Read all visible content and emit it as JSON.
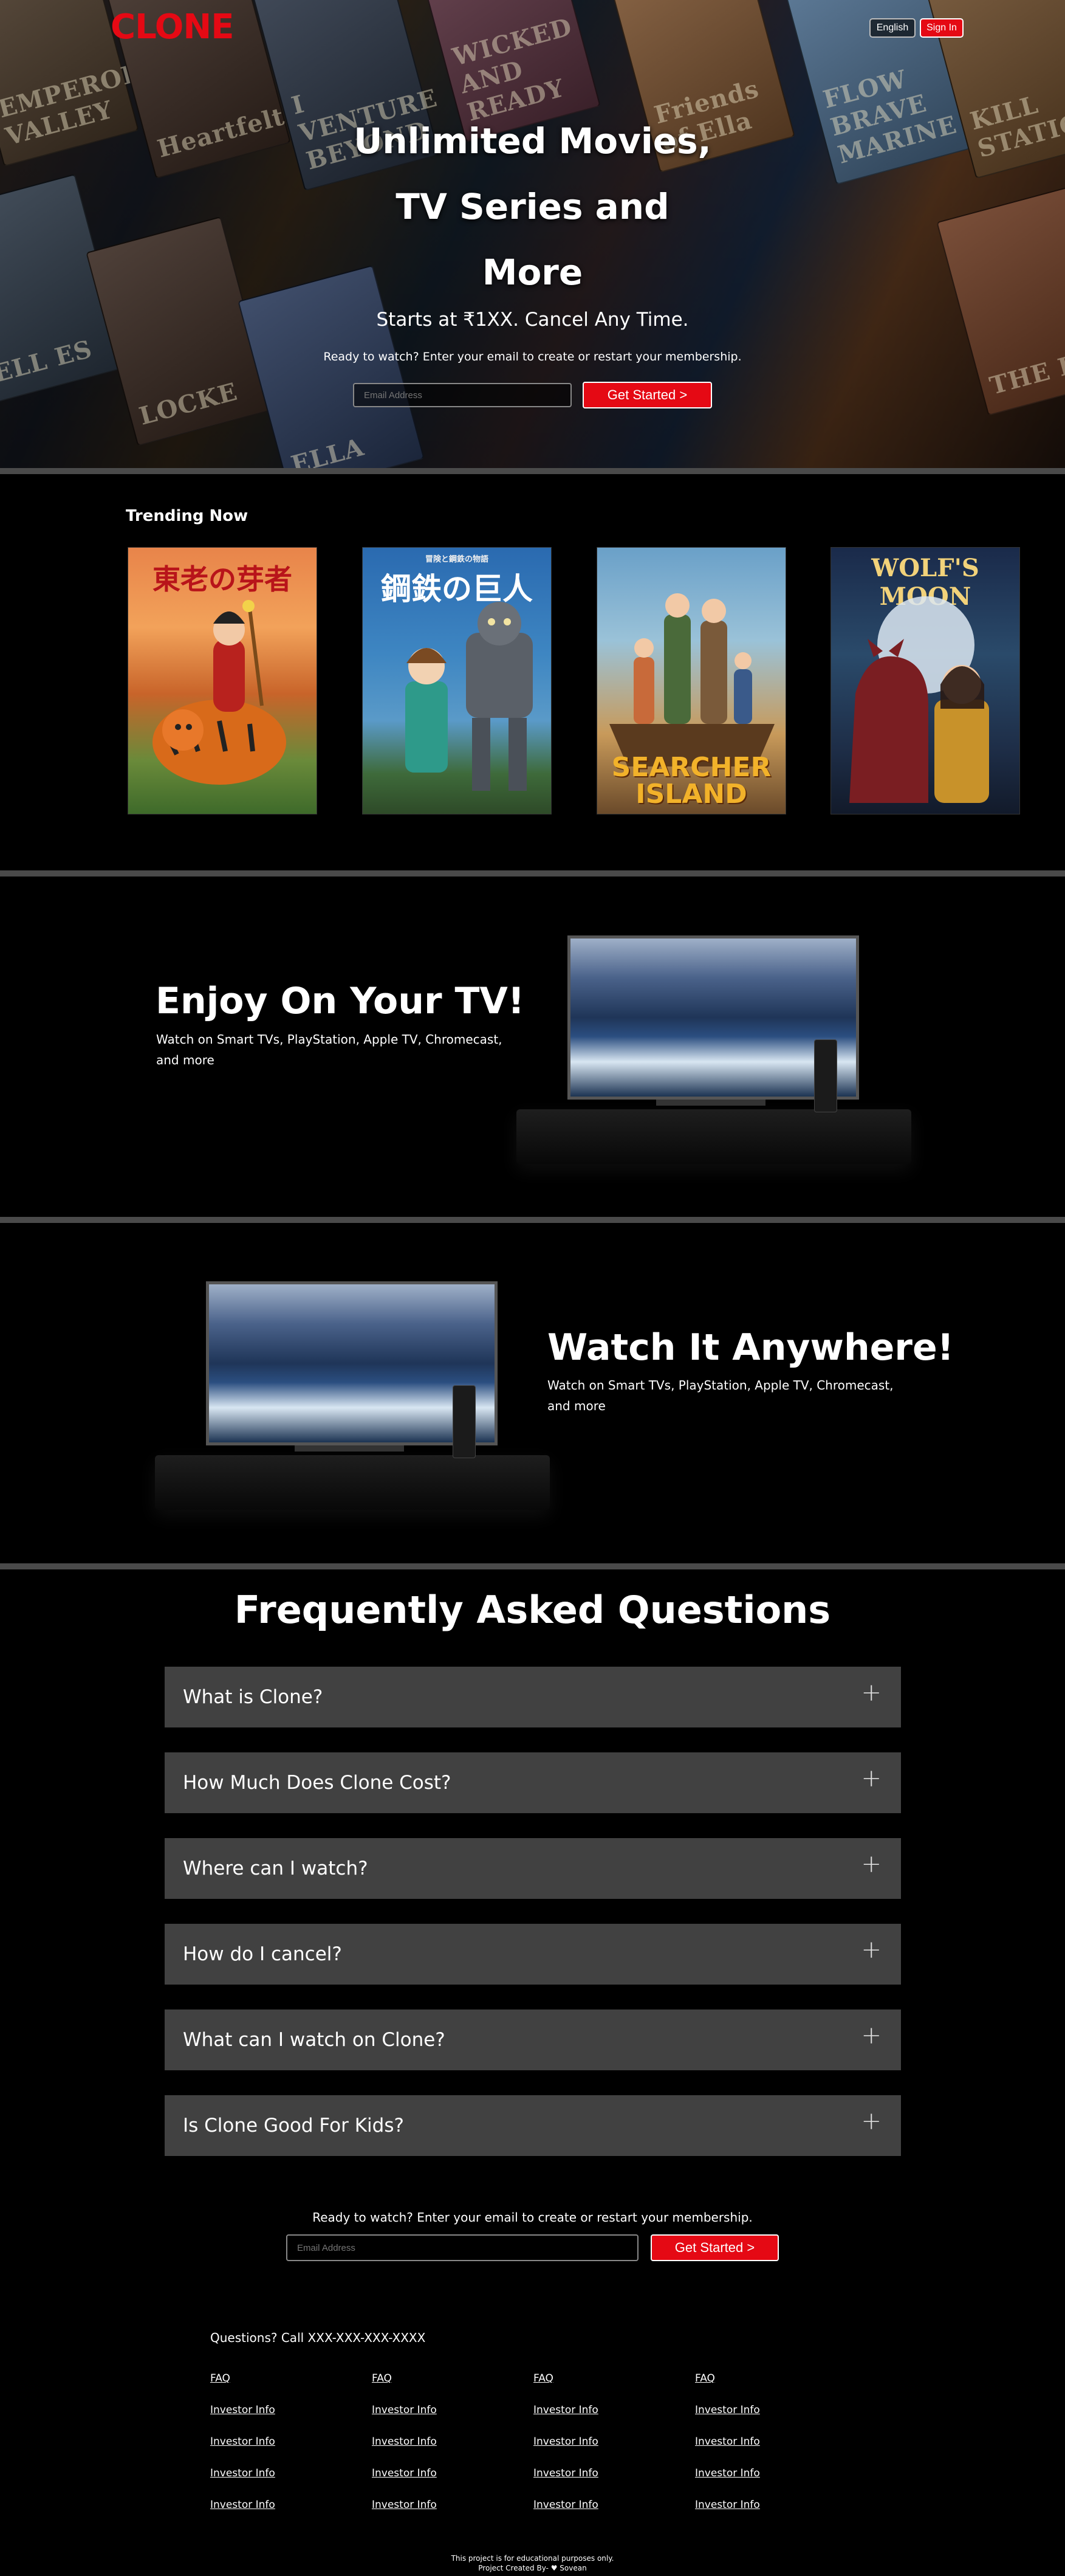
{
  "brand": {
    "logo": "CLONE",
    "accent": "#e50914"
  },
  "header": {
    "language_label": "English",
    "signin_label": "Sign In"
  },
  "hero": {
    "title_lines": [
      "Unlimited Movies,",
      "TV Series and",
      "More"
    ],
    "subtitle": "Starts at ₹1XX. Cancel Any Time.",
    "prompt": "Ready to watch? Enter your email to create or restart your membership.",
    "email_placeholder": "Email Address",
    "cta_label": "Get Started >",
    "background_posters": [
      "EMPEROR VALLEY",
      "Heartfelt",
      "I VENTURE BEYOND",
      "WICKED AND READY",
      "Friends of Ella",
      "FLOW BRAVE MARINE",
      "KILL STATION",
      "ELL ES",
      "LOCKE",
      "ELLA",
      "THE PI"
    ]
  },
  "trending": {
    "title": "Trending Now",
    "items": [
      {
        "title": "東老の芽者",
        "icon": "tiger-rider-poster"
      },
      {
        "title": "鋼鉄の巨人",
        "subtitle": "冒険と鋼鉄の物語",
        "icon": "iron-giant-poster"
      },
      {
        "title": "SEARCHER ISLAND",
        "icon": "searcher-island-poster"
      },
      {
        "title": "WOLF'S MOON",
        "icon": "wolfs-moon-poster"
      }
    ]
  },
  "features": [
    {
      "heading": "Enjoy On Your TV!",
      "text": "Watch on Smart TVs, PlayStation, Apple TV, Chromecast, and more"
    },
    {
      "heading": "Watch It Anywhere!",
      "text": "Watch on Smart TVs, PlayStation, Apple TV, Chromecast, and more"
    }
  ],
  "faq": {
    "title": "Frequently Asked Questions",
    "items": [
      "What is Clone?",
      "How Much Does Clone Cost?",
      "Where can I watch?",
      "How do I cancel?",
      "What can I watch on Clone?",
      "Is Clone Good For Kids?"
    ],
    "expand_icon": "plus-icon"
  },
  "footer_cta": {
    "prompt": "Ready to watch? Enter your email to create or restart your membership.",
    "email_placeholder": "Email Address",
    "cta_label": "Get Started >"
  },
  "footer": {
    "contact": "Questions? Call XXX-XXX-XXX-XXXX",
    "columns": [
      [
        "FAQ",
        "Investor Info",
        "Investor Info",
        "Investor Info",
        "Investor Info"
      ],
      [
        "FAQ",
        "Investor Info",
        "Investor Info",
        "Investor Info",
        "Investor Info"
      ],
      [
        "FAQ",
        "Investor Info",
        "Investor Info",
        "Investor Info",
        "Investor Info"
      ],
      [
        "FAQ",
        "Investor Info",
        "Investor Info",
        "Investor Info",
        "Investor Info"
      ]
    ],
    "note1": "This project is for educational purposes only.",
    "note2": "Project Created By- ♥ Sovean"
  }
}
